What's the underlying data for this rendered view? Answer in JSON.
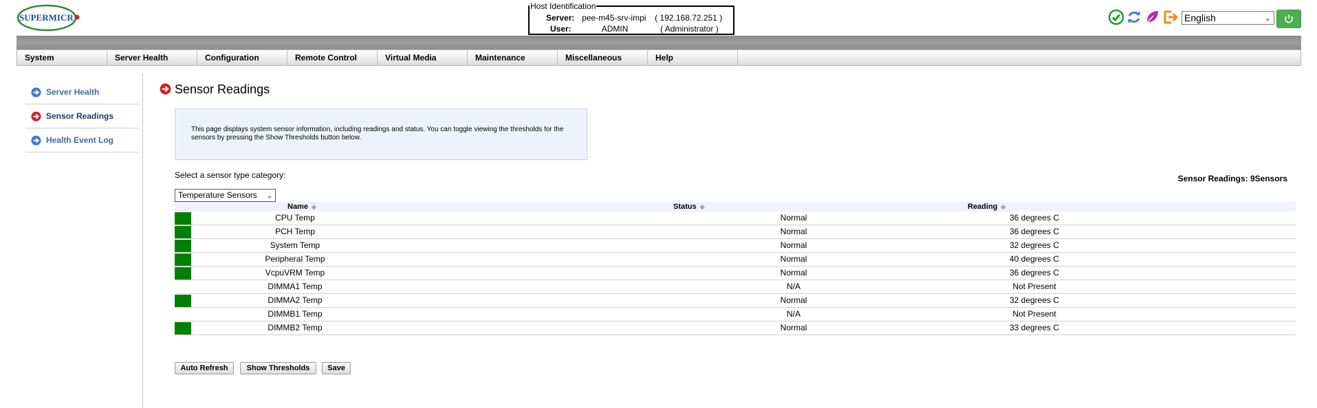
{
  "header": {
    "logo_text": "SUPERMICRO",
    "host_legend": "Host Identification",
    "server_label": "Server:",
    "server_name": "pee-m45-srv-impi",
    "server_ip": "( 192.168.72.251 )",
    "user_label": "User:",
    "user_name": "ADMIN",
    "user_role": "( Administrator )",
    "icons": [
      "check-icon",
      "refresh-icon",
      "feather-icon",
      "logout-icon"
    ],
    "language": "English",
    "power_icon": "power-icon"
  },
  "menu": [
    "System",
    "Server Health",
    "Configuration",
    "Remote Control",
    "Virtual Media",
    "Maintenance",
    "Miscellaneous",
    "Help"
  ],
  "sidebar": [
    {
      "label": "Server Health",
      "active": false
    },
    {
      "label": "Sensor Readings",
      "active": true
    },
    {
      "label": "Health Event Log",
      "active": false
    }
  ],
  "main": {
    "title": "Sensor Readings",
    "info": "This page displays system sensor information, including readings and status. You can toggle viewing the thresholds for the sensors by pressing the Show Thresholds button below.",
    "select_label": "Select a sensor type category:",
    "sensor_type": "Temperature Sensors",
    "sensor_count": "Sensor Readings: 9Sensors",
    "columns": [
      "Name",
      "Status",
      "Reading"
    ],
    "rows": [
      {
        "name": "CPU Temp",
        "status": "Normal",
        "reading": "36 degrees C",
        "ok": true
      },
      {
        "name": "PCH Temp",
        "status": "Normal",
        "reading": "36 degrees C",
        "ok": true
      },
      {
        "name": "System Temp",
        "status": "Normal",
        "reading": "32 degrees C",
        "ok": true
      },
      {
        "name": "Peripheral Temp",
        "status": "Normal",
        "reading": "40 degrees C",
        "ok": true
      },
      {
        "name": "VcpuVRM Temp",
        "status": "Normal",
        "reading": "36 degrees C",
        "ok": true
      },
      {
        "name": "DIMMA1 Temp",
        "status": "N/A",
        "reading": "Not Present",
        "ok": false
      },
      {
        "name": "DIMMA2 Temp",
        "status": "Normal",
        "reading": "32 degrees C",
        "ok": true
      },
      {
        "name": "DIMMB1 Temp",
        "status": "N/A",
        "reading": "Not Present",
        "ok": false
      },
      {
        "name": "DIMMB2 Temp",
        "status": "Normal",
        "reading": "33 degrees C",
        "ok": true
      }
    ],
    "buttons": {
      "auto_refresh": "Auto Refresh",
      "show_thresholds": "Show Thresholds",
      "save": "Save"
    }
  },
  "colors": {
    "status_ok": "#008000",
    "accent_blue": "#3a6ea5",
    "power_green": "#4cae4c"
  }
}
